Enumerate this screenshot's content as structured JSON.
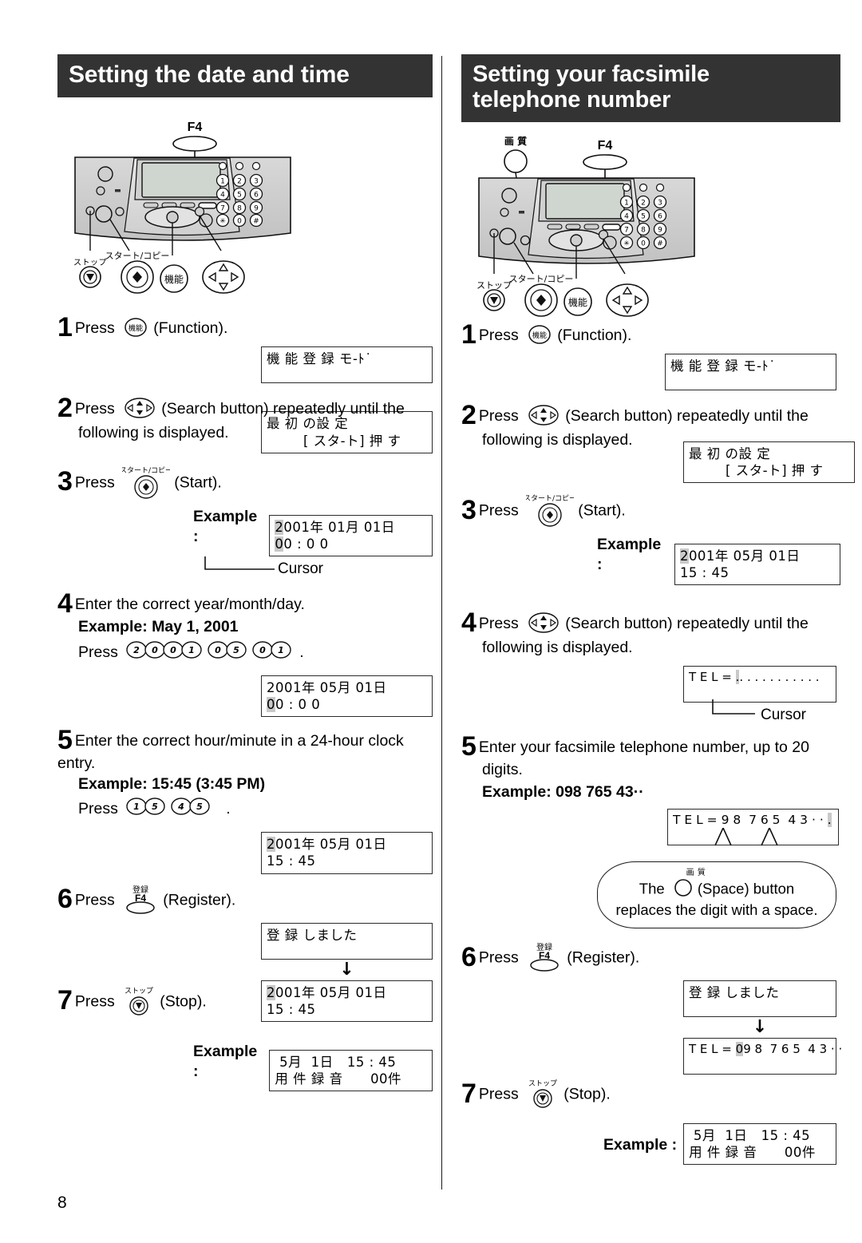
{
  "page": {
    "number": "8"
  },
  "left_section": {
    "title": "Setting the date and time",
    "diagram": {
      "callout_f4": "F4",
      "label_stop": "ストップ",
      "label_start": "スタート/コピー",
      "label_function": "機能",
      "keypad": [
        "1",
        "2",
        "3",
        "4",
        "5",
        "6",
        "7",
        "8",
        "9",
        "*",
        "0",
        "#"
      ]
    },
    "steps": [
      {
        "num": "1",
        "text_before": "Press",
        "button_label": "機能",
        "text_after": "(Function)."
      },
      {
        "num": "2",
        "text_before": "Press",
        "text_after": "(Search button) repeatedly until the",
        "text_line2": "following is displayed."
      },
      {
        "num": "3",
        "text_before": "Press",
        "button_caption": "スタート/コピー",
        "text_after": "(Start)."
      },
      {
        "num": "4",
        "text": "Enter the correct year/month/day.",
        "example_label": "Example: May 1, 2001",
        "press_label": "Press",
        "keys": [
          "2",
          "0",
          "0",
          "1",
          "0",
          "5",
          "0",
          "1"
        ],
        "period": "."
      },
      {
        "num": "5",
        "text": "Enter the correct hour/minute in a 24-hour clock entry.",
        "example_label": "Example: 15:45 (3:45 PM)",
        "press_label": "Press",
        "keys": [
          "1",
          "5",
          "4",
          "5"
        ],
        "period": "."
      },
      {
        "num": "6",
        "text_before": "Press",
        "button_caption": "登録",
        "button_label": "F4",
        "text_after": "(Register)."
      },
      {
        "num": "7",
        "text_before": "Press",
        "button_caption": "ストップ",
        "text_after": "(Stop)."
      }
    ],
    "displays": {
      "function_mode": {
        "line1": "機 能 登 録 モ-ﾄ˙",
        "line2": ""
      },
      "initial_setting": {
        "line1": "最 初 の設 定",
        "line2": "        [ スタ-ト] 押 す"
      },
      "date_initial": {
        "cursor": "2",
        "line1_rest": "001年 01月 01日",
        "line2_cursor": "0",
        "line2_rest": "0 : 0 0"
      },
      "date_entered": {
        "line1": "2001年 05月 01日",
        "line2_cursor": "0",
        "line2_rest": "0 : 0 0"
      },
      "datetime_entered": {
        "cursor": "2",
        "line1_rest": "001年 05月 01日",
        "line2": "15 : 45"
      },
      "registered": {
        "line1": "登 録 しました",
        "line2": ""
      },
      "datetime_final": {
        "cursor": "2",
        "line1_rest": "001年 05月 01日",
        "line2": "15 : 45"
      },
      "standby": {
        "line1": " 5月  1日   15 : 45",
        "line2": "用 件 録 音      00件"
      }
    },
    "labels": {
      "example": "Example :",
      "cursor": "Cursor",
      "arrow": "↓"
    }
  },
  "right_section": {
    "title_line1": "Setting your facsimile",
    "title_line2": "telephone number",
    "diagram": {
      "callout_f4": "F4",
      "callout_quality": "画 質",
      "label_stop": "ストップ",
      "label_start": "スタート/コピー",
      "label_function": "機能",
      "keypad": [
        "1",
        "2",
        "3",
        "4",
        "5",
        "6",
        "7",
        "8",
        "9",
        "*",
        "0",
        "#"
      ]
    },
    "steps": [
      {
        "num": "1",
        "text_before": "Press",
        "button_label": "機能",
        "text_after": "(Function)."
      },
      {
        "num": "2",
        "text_before": "Press",
        "text_after": "(Search button) repeatedly until the",
        "text_line2": "following is displayed."
      },
      {
        "num": "3",
        "text_before": "Press",
        "button_caption": "スタート/コピー",
        "text_after": "(Start)."
      },
      {
        "num": "4",
        "text_before": "Press",
        "text_after": "(Search button) repeatedly until the",
        "text_line2": "following is displayed."
      },
      {
        "num": "5",
        "text": "Enter your facsimile telephone number, up to 20",
        "text_line2": "digits.",
        "example_label": "Example: 098 765 43··"
      },
      {
        "num": "6",
        "text_before": "Press",
        "button_caption": "登録",
        "button_label": "F4",
        "text_after": "(Register)."
      },
      {
        "num": "7",
        "text_before": "Press",
        "button_caption": "ストップ",
        "text_after": "(Stop)."
      }
    ],
    "displays": {
      "function_mode": {
        "line1": "機 能 登 録 モ-ﾄ˙",
        "line2": ""
      },
      "initial_setting": {
        "line1": "最 初 の設 定",
        "line2": "        [ スタ-ト] 押 す"
      },
      "datetime": {
        "cursor": "2",
        "line1_rest": "001年 05月 01日",
        "line2": "15 : 45"
      },
      "tel_empty": {
        "prefix": "T E L = ",
        "cursor": ".",
        "rest": ". . . . . . . . . . ."
      },
      "tel_entered": {
        "prefix": "T E L = 9 8  7 6 5  4 3 · · ",
        "cursor": "."
      },
      "registered": {
        "line1": "登 録 しました",
        "line2": ""
      },
      "tel_final": {
        "prefix": "T E L = ",
        "cursor": "0",
        "rest": "9 8  7 6 5  4 3 · ·"
      },
      "standby": {
        "line1": " 5月  1日   15 : 45",
        "line2": "用 件 録 音      00件"
      }
    },
    "bubble": {
      "quality_caption": "画 質",
      "text_before": "The",
      "text_mid": "(Space) button",
      "text_after": "replaces the digit with a space."
    },
    "labels": {
      "example": "Example :",
      "cursor": "Cursor",
      "arrow": "↓"
    }
  }
}
